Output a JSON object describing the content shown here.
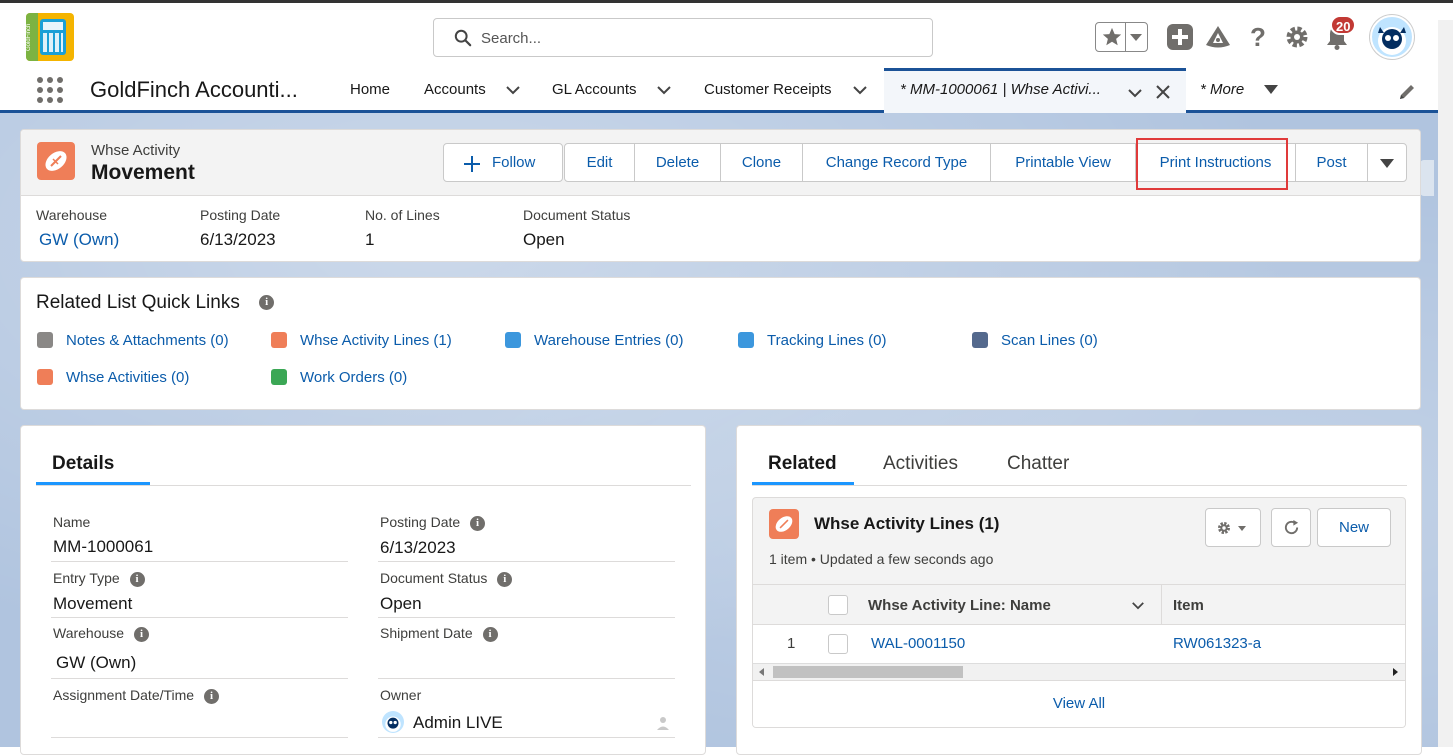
{
  "header": {
    "app_logo_text": "GoldFinch",
    "search_placeholder": "Search...",
    "notification_count": "20",
    "icons": [
      "star-icon",
      "chevron-down-icon",
      "plus-icon",
      "trailhead-icon",
      "help-icon",
      "gear-icon",
      "bell-icon",
      "avatar"
    ]
  },
  "nav": {
    "app_name": "GoldFinch Accounti...",
    "items": [
      {
        "label": "Home"
      },
      {
        "label": "Accounts"
      },
      {
        "label": "GL Accounts"
      },
      {
        "label": "Customer Receipts"
      }
    ],
    "active_tab": "* MM-1000061 | Whse Activi...",
    "more": "* More"
  },
  "record": {
    "object_type": "Whse Activity",
    "name": "Movement",
    "actions": {
      "follow": "Follow",
      "edit": "Edit",
      "delete": "Delete",
      "clone": "Clone",
      "change_record_type": "Change Record Type",
      "printable_view": "Printable View",
      "print_instructions": "Print Instructions",
      "post": "Post"
    },
    "highlights": [
      {
        "label": "Warehouse",
        "value": "GW (Own)"
      },
      {
        "label": "Posting Date",
        "value": "6/13/2023"
      },
      {
        "label": "No. of Lines",
        "value": "1"
      },
      {
        "label": "Document Status",
        "value": "Open"
      }
    ]
  },
  "quick_links": {
    "title": "Related List Quick Links",
    "items": [
      {
        "label": "Notes & Attachments (0)"
      },
      {
        "label": "Whse Activity Lines (1)"
      },
      {
        "label": "Warehouse Entries (0)"
      },
      {
        "label": "Tracking Lines (0)"
      },
      {
        "label": "Scan Lines (0)"
      },
      {
        "label": "Whse Activities (0)"
      },
      {
        "label": "Work Orders (0)"
      }
    ]
  },
  "details": {
    "tab": "Details",
    "fields": {
      "name_label": "Name",
      "name_value": "MM-1000061",
      "posting_date_label": "Posting Date",
      "posting_date_value": "6/13/2023",
      "entry_type_label": "Entry Type",
      "entry_type_value": "Movement",
      "document_status_label": "Document Status",
      "document_status_value": "Open",
      "warehouse_label": "Warehouse",
      "warehouse_value": "GW (Own)",
      "shipment_date_label": "Shipment Date",
      "shipment_date_value": "",
      "assignment_label": "Assignment Date/Time",
      "assignment_value": "",
      "owner_label": "Owner",
      "owner_value": "Admin LIVE"
    }
  },
  "related": {
    "tabs": [
      "Related",
      "Activities",
      "Chatter"
    ],
    "list_title": "Whse Activity Lines (1)",
    "list_subtitle": "1 item • Updated a few seconds ago",
    "new_button": "New",
    "columns": [
      "Whse Activity Line: Name",
      "Item"
    ],
    "rows": [
      {
        "num": "1",
        "name": "WAL-0001150",
        "item": "RW061323-a"
      }
    ],
    "view_all": "View All"
  },
  "colors": {
    "brand_blue": "#1b5297",
    "link": "#0b5cab",
    "object_icon": "#ef7e58",
    "highlight_box": "#e03a3a",
    "notification_badge": "#c23934"
  }
}
